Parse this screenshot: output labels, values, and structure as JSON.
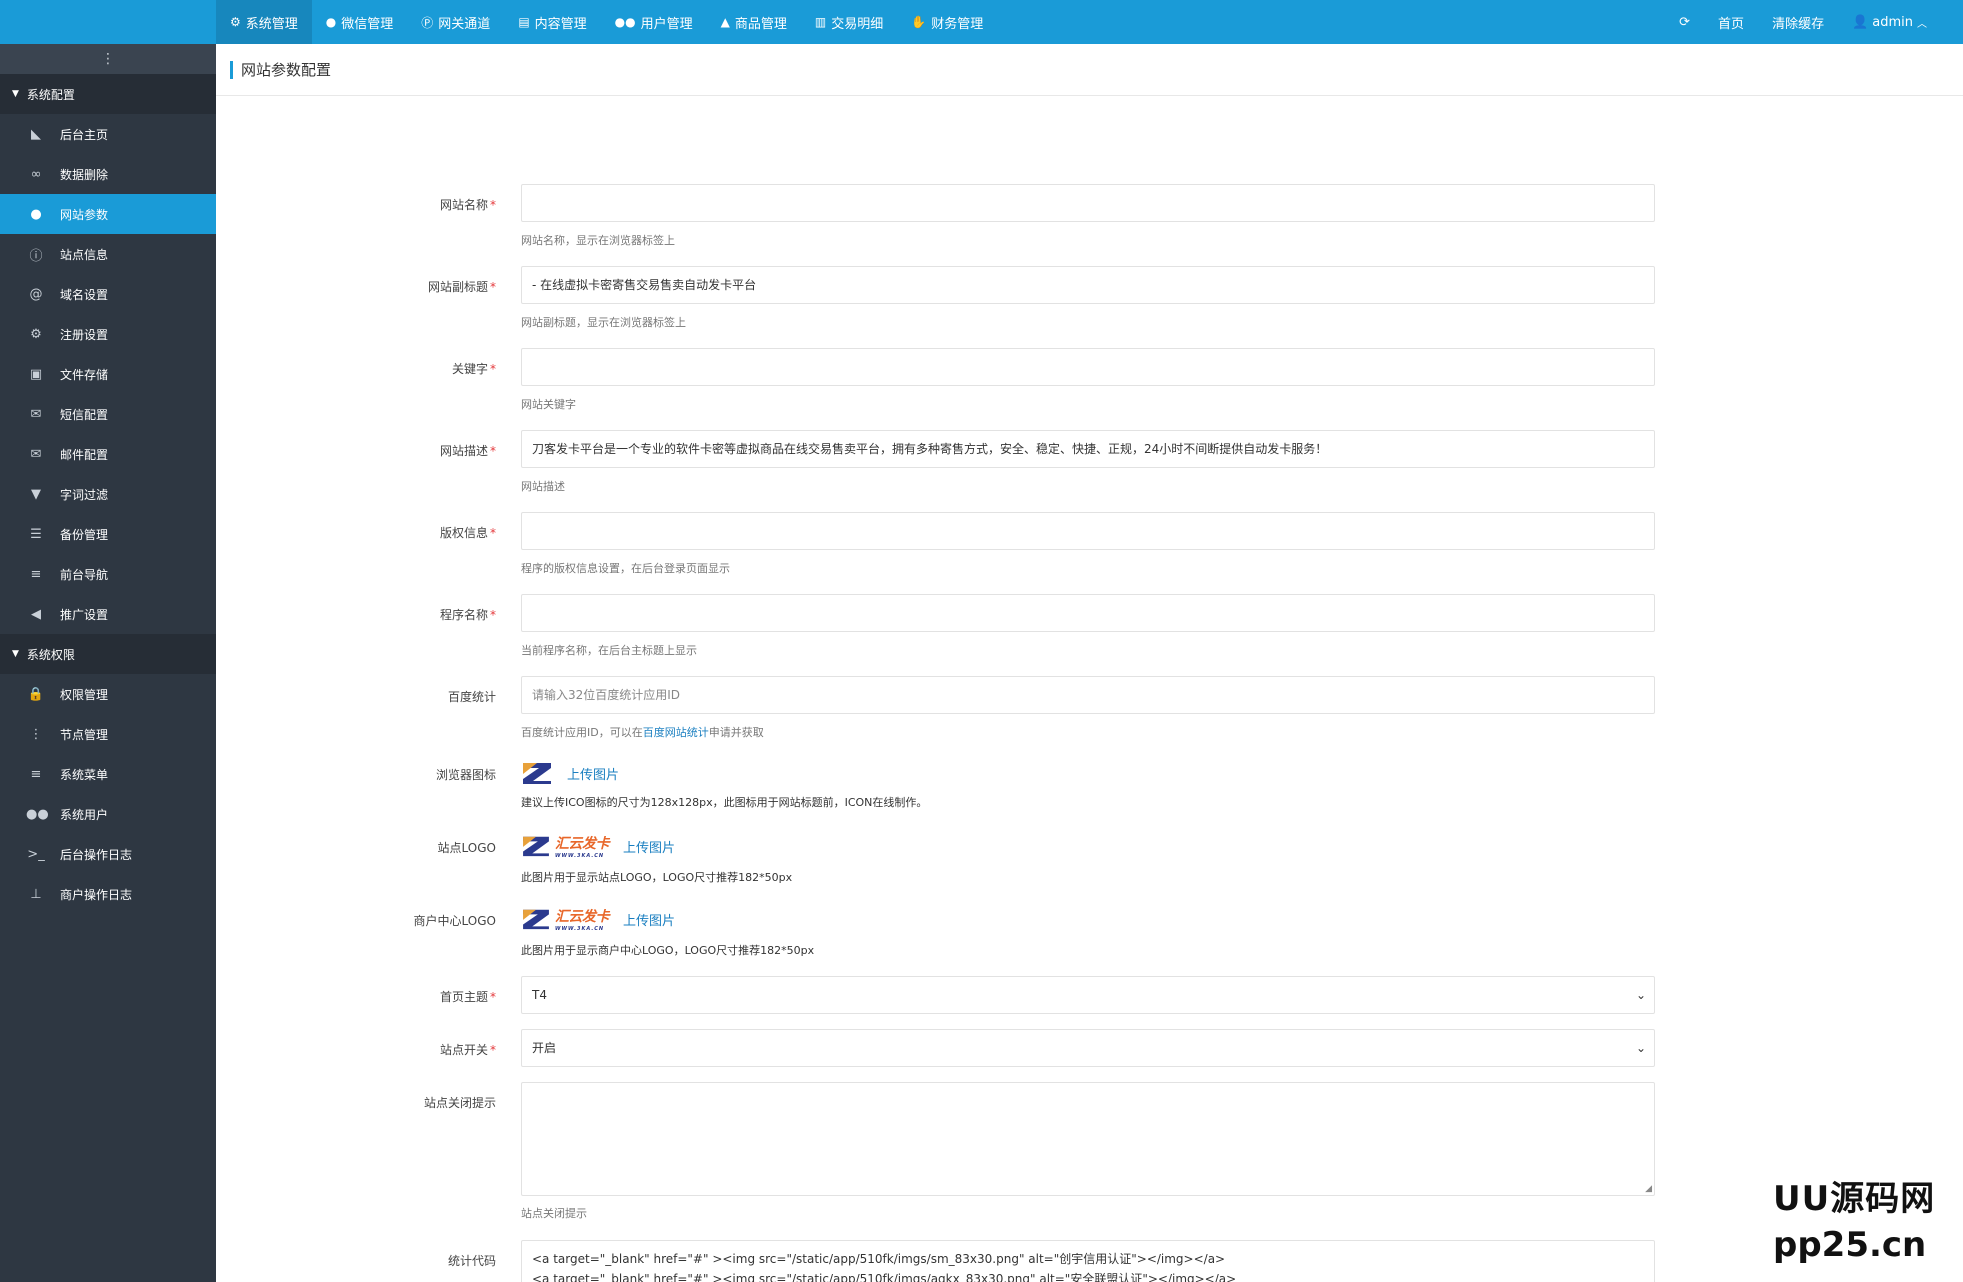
{
  "top_nav": {
    "items": [
      {
        "label": "系统管理",
        "icon": "gear-icon",
        "active": true
      },
      {
        "label": "微信管理",
        "icon": "wechat-icon"
      },
      {
        "label": "网关通道",
        "icon": "paypal-icon"
      },
      {
        "label": "内容管理",
        "icon": "document-icon"
      },
      {
        "label": "用户管理",
        "icon": "users-icon"
      },
      {
        "label": "商品管理",
        "icon": "shopping-bag-icon"
      },
      {
        "label": "交易明细",
        "icon": "bar-chart-icon"
      },
      {
        "label": "财务管理",
        "icon": "hand-money-icon"
      }
    ],
    "right": {
      "refresh_icon": "refresh-icon",
      "home": "首页",
      "clear_cache": "清除缓存",
      "user": "admin"
    }
  },
  "sidebar": {
    "groups": [
      {
        "title": "系统配置",
        "items": [
          {
            "label": "后台主页",
            "icon": "area-chart-icon"
          },
          {
            "label": "数据删除",
            "icon": "link-icon"
          },
          {
            "label": "网站参数",
            "icon": "apple-icon",
            "active": true
          },
          {
            "label": "站点信息",
            "icon": "info-icon"
          },
          {
            "label": "域名设置",
            "icon": "at-icon"
          },
          {
            "label": "注册设置",
            "icon": "gear-icon"
          },
          {
            "label": "文件存储",
            "icon": "floppy-icon"
          },
          {
            "label": "短信配置",
            "icon": "envelope-icon"
          },
          {
            "label": "邮件配置",
            "icon": "envelope-icon"
          },
          {
            "label": "字词过滤",
            "icon": "filter-icon"
          },
          {
            "label": "备份管理",
            "icon": "database-icon"
          },
          {
            "label": "前台导航",
            "icon": "list-icon"
          },
          {
            "label": "推广设置",
            "icon": "bullhorn-icon"
          }
        ]
      },
      {
        "title": "系统权限",
        "items": [
          {
            "label": "权限管理",
            "icon": "lock-icon"
          },
          {
            "label": "节点管理",
            "icon": "ellipsis-icon"
          },
          {
            "label": "系统菜单",
            "icon": "list-icon"
          },
          {
            "label": "系统用户",
            "icon": "users-icon"
          },
          {
            "label": "后台操作日志",
            "icon": "terminal-icon"
          },
          {
            "label": "商户操作日志",
            "icon": "pin-icon"
          }
        ]
      }
    ]
  },
  "page": {
    "title": "网站参数配置"
  },
  "form": {
    "site_name": {
      "label": "网站名称",
      "value": "",
      "help": "网站名称，显示在浏览器标签上"
    },
    "site_subtitle": {
      "label": "网站副标题",
      "value": "- 在线虚拟卡密寄售交易售卖自动发卡平台",
      "help": "网站副标题，显示在浏览器标签上"
    },
    "keywords": {
      "label": "关键字",
      "value": "",
      "help": "网站关键字"
    },
    "description": {
      "label": "网站描述",
      "value": "刀客发卡平台是一个专业的软件卡密等虚拟商品在线交易售卖平台，拥有多种寄售方式，安全、稳定、快捷、正规，24小时不间断提供自动发卡服务！",
      "help": "网站描述"
    },
    "copyright": {
      "label": "版权信息",
      "value": "",
      "help": "程序的版权信息设置，在后台登录页面显示"
    },
    "program_name": {
      "label": "程序名称",
      "value": "",
      "help": "当前程序名称，在后台主标题上显示"
    },
    "baidu": {
      "label": "百度统计",
      "placeholder": "请输入32位百度统计应用ID",
      "help_prefix": "百度统计应用ID，可以在",
      "help_link": "百度网站统计",
      "help_suffix": "申请并获取"
    },
    "favicon": {
      "label": "浏览器图标",
      "upload": "上传图片",
      "help": "建议上传ICO图标的尺寸为128x128px，此图标用于网站标题前，ICON在线制作。"
    },
    "site_logo": {
      "label": "站点LOGO",
      "brand": "汇云发卡",
      "brand_sub": "WWW.3KA.CN",
      "upload": "上传图片",
      "help": "此图片用于显示站点LOGO，LOGO尺寸推荐182*50px"
    },
    "merchant_logo": {
      "label": "商户中心LOGO",
      "brand": "汇云发卡",
      "brand_sub": "WWW.3KA.CN",
      "upload": "上传图片",
      "help": "此图片用于显示商户中心LOGO，LOGO尺寸推荐182*50px"
    },
    "theme": {
      "label": "首页主题",
      "value": "T4"
    },
    "site_switch": {
      "label": "站点开关",
      "value": "开启"
    },
    "close_tip": {
      "label": "站点关闭提示",
      "value": "",
      "help": "站点关闭提示"
    },
    "stats_code": {
      "label": "统计代码",
      "value": "<a target=\"_blank\" href=\"#\" ><img src=\"/static/app/510fk/imgs/sm_83x30.png\" alt=\"创宇信用认证\"></img></a>\n<a target=\"_blank\" href=\"#\" ><img src=\"/static/app/510fk/imgs/aqkx_83x30.png\" alt=\"安全联盟认证\"></img></a>"
    }
  },
  "watermark": {
    "line1": "UU源码网",
    "line2": "pp25.cn"
  },
  "colors": {
    "primary": "#1a9bd7",
    "sidebar": "#2e3742",
    "required": "#e4393c"
  }
}
